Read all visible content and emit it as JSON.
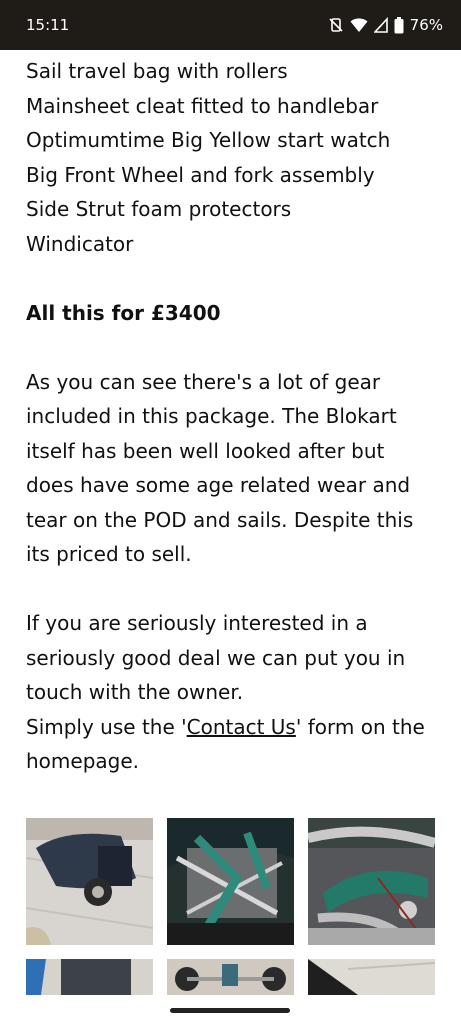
{
  "status_bar": {
    "time": "15:11",
    "battery": "76%",
    "icons": [
      "mute-vibrate-icon",
      "wifi-icon",
      "cell-signal-icon",
      "battery-icon"
    ]
  },
  "list_items": [
    "Sail travel bag with rollers",
    "Mainsheet cleat fitted to handlebar",
    "Optimumtime Big Yellow start watch",
    "Big Front Wheel and fork assembly",
    "Side Strut foam protectors",
    "Windicator"
  ],
  "price_line": "All this for £3400",
  "description": [
    "As you can see there's a lot of gear",
    "included in this package. The Blokart",
    "itself has been well looked after but",
    "does have some age related wear and",
    "tear on the POD and sails. Despite this",
    "its priced to sell."
  ],
  "interest": [
    "If you are seriously interested in a",
    "seriously good deal we can put you in",
    "touch with the owner."
  ],
  "contact": {
    "prefix": "Simply use the '",
    "link": "Contact Us",
    "suffix": "' form on the",
    "line2": "homepage."
  },
  "gallery_count": 6
}
